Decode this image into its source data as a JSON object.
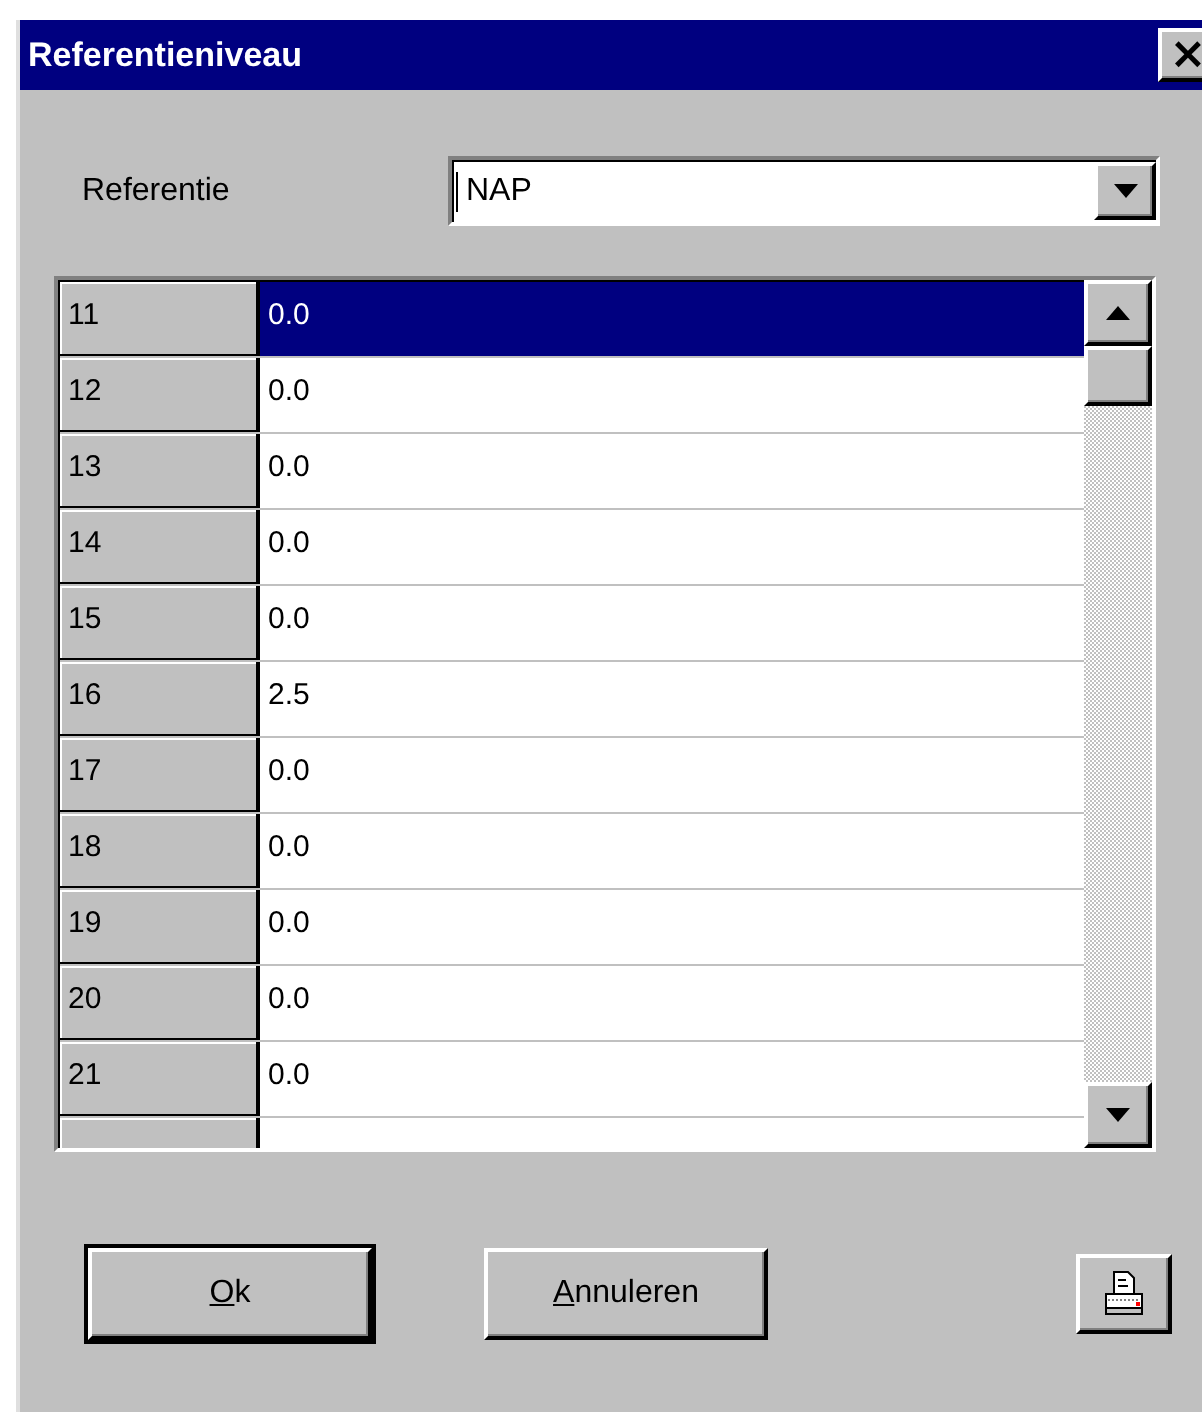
{
  "window": {
    "title": "Referentieniveau",
    "close": "×"
  },
  "reference": {
    "label": "Referentie",
    "value": "NAP"
  },
  "rows": [
    {
      "number": "11",
      "value": "0.0",
      "selected": true
    },
    {
      "number": "12",
      "value": "0.0",
      "selected": false
    },
    {
      "number": "13",
      "value": "0.0",
      "selected": false
    },
    {
      "number": "14",
      "value": "0.0",
      "selected": false
    },
    {
      "number": "15",
      "value": "0.0",
      "selected": false
    },
    {
      "number": "16",
      "value": "2.5",
      "selected": false
    },
    {
      "number": "17",
      "value": "0.0",
      "selected": false
    },
    {
      "number": "18",
      "value": "0.0",
      "selected": false
    },
    {
      "number": "19",
      "value": "0.0",
      "selected": false
    },
    {
      "number": "20",
      "value": "0.0",
      "selected": false
    },
    {
      "number": "21",
      "value": "0.0",
      "selected": false
    }
  ],
  "buttons": [
    {
      "key": "O",
      "rest": "k",
      "default": true
    },
    {
      "key": "A",
      "rest": "nnuleren",
      "default": false
    }
  ]
}
